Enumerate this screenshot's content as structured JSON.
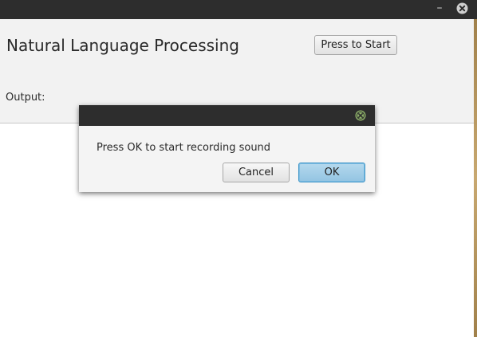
{
  "window": {
    "minimize_glyph": "–",
    "close_icon": "close-circle-icon",
    "titlebar_color": "#2d2d2d"
  },
  "main": {
    "title": "Natural Language Processing",
    "start_button_label": "Press to Start",
    "output_label": "Output:"
  },
  "dialog": {
    "message": "Press OK to start recording sound",
    "cancel_label": "Cancel",
    "ok_label": "OK",
    "close_icon": "close-circle-icon",
    "ok_color": "#93c4e2",
    "close_icon_color": "#8fb26a"
  }
}
